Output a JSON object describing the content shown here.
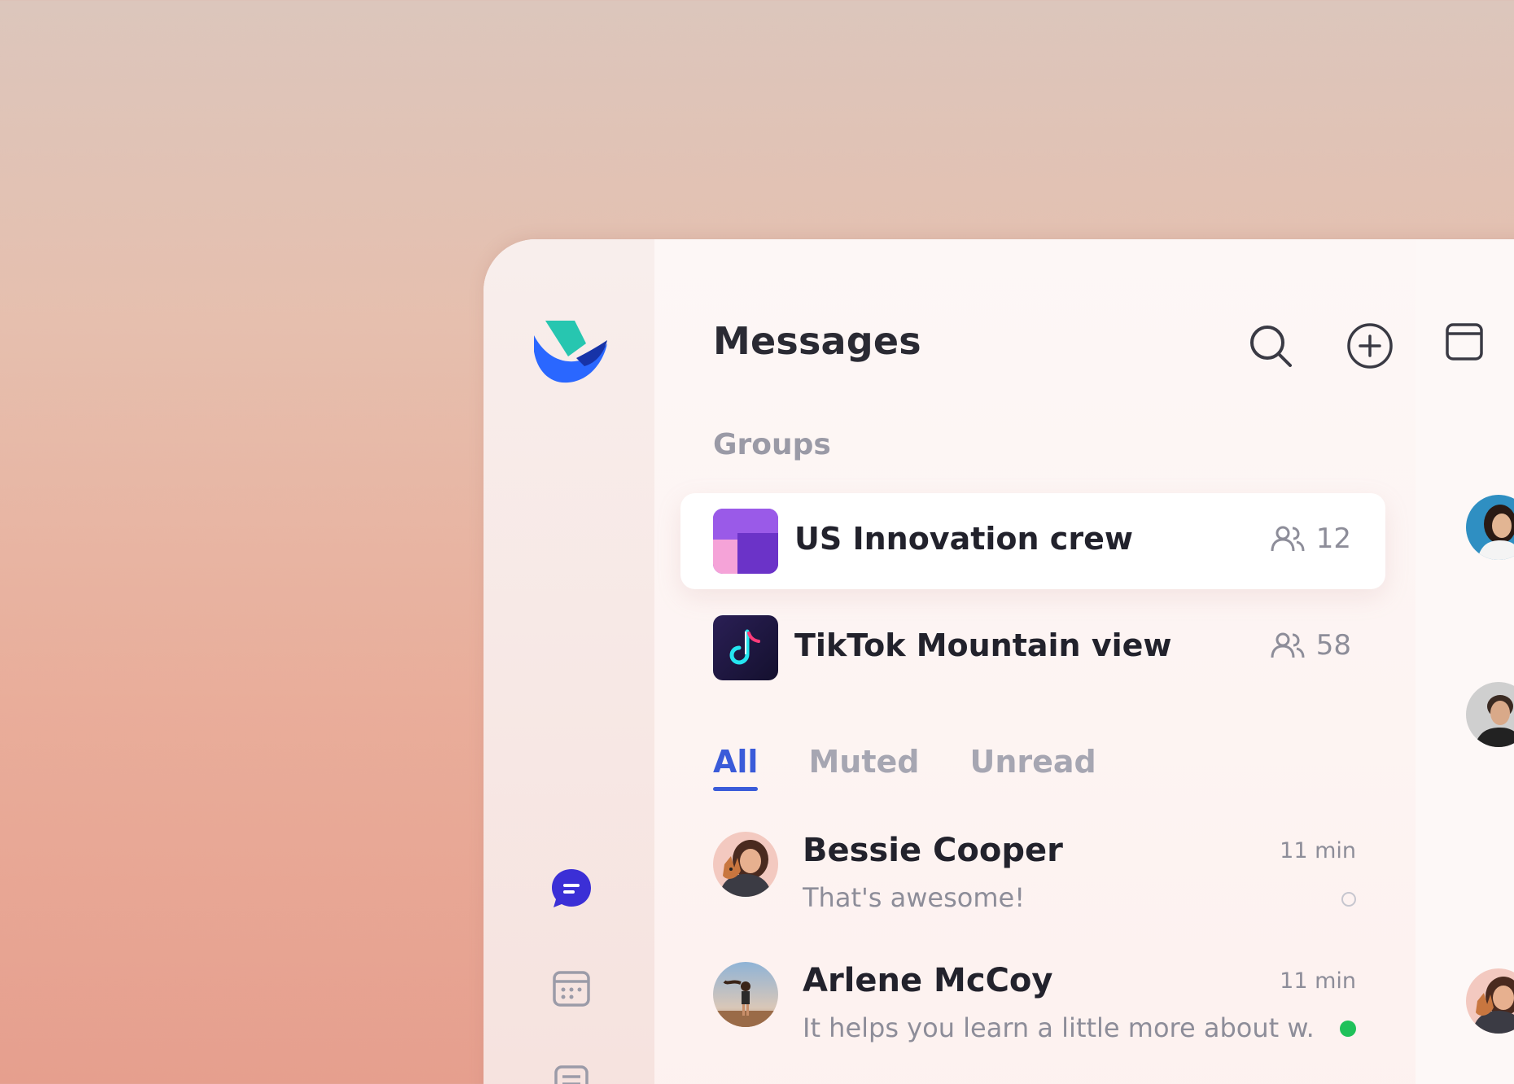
{
  "header": {
    "title": "Messages",
    "search_icon": "search-icon",
    "add_icon": "plus-circle-icon",
    "window_icon": "window-icon"
  },
  "groups": {
    "label": "Groups",
    "items": [
      {
        "name": "US Innovation crew",
        "count": "12",
        "active": true
      },
      {
        "name": "TikTok Mountain view",
        "count": "58",
        "active": false
      }
    ]
  },
  "tabs": [
    {
      "label": "All",
      "active": true
    },
    {
      "label": "Muted",
      "active": false
    },
    {
      "label": "Unread",
      "active": false
    }
  ],
  "chats": [
    {
      "name": "Bessie Cooper",
      "time": "11 min",
      "message": "That's awesome!",
      "status": "read"
    },
    {
      "name": "Arlene McCoy",
      "time": "11 min",
      "message": "It helps you learn a little more about w...",
      "status": "unread"
    }
  ],
  "colors": {
    "accent": "#3a5bd9",
    "chat_icon": "#3b2fd6",
    "online": "#1fc15a"
  }
}
